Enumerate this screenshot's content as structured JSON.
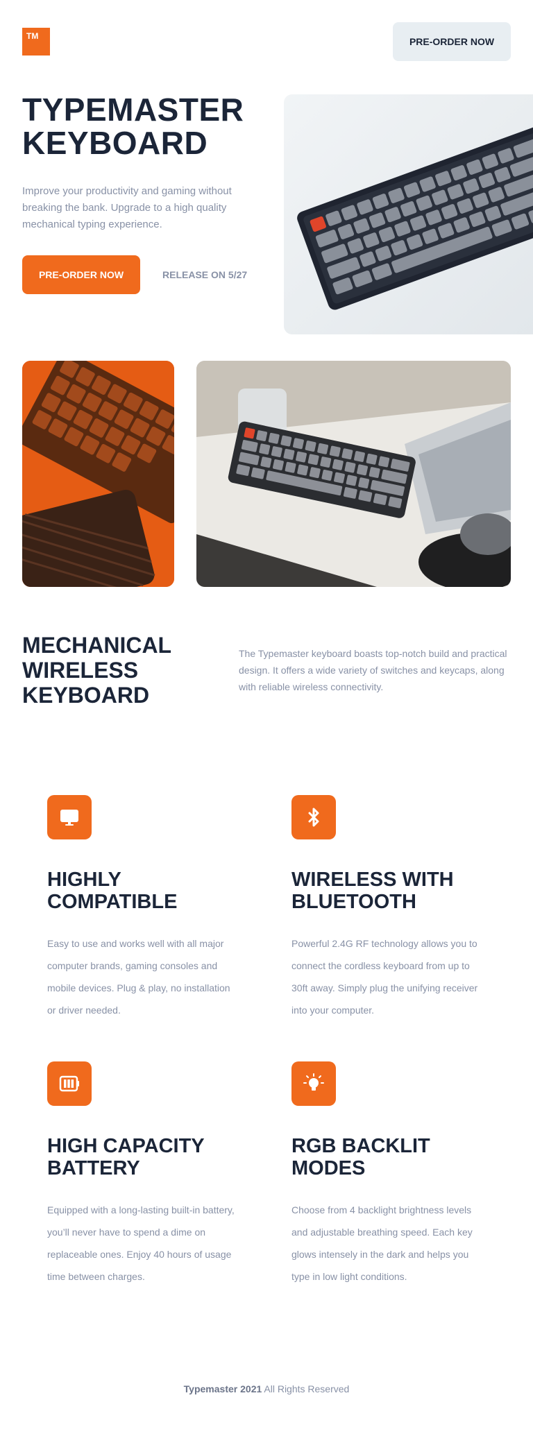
{
  "brand": {
    "logo": "TM",
    "accent": "#f06a1d"
  },
  "header": {
    "preorder_label": "PRE-ORDER NOW"
  },
  "hero": {
    "title": "TYPEMASTER KEYBOARD",
    "description": "Improve your productivity and gaming without breaking the bank. Upgrade to a high quality mechanical typing experience.",
    "preorder_label": "PRE-ORDER NOW",
    "release": "RELEASE ON 5/27"
  },
  "about": {
    "title": "MECHANICAL WIRELESS KEYBOARD",
    "description": "The Typemaster keyboard boasts top-notch build and practical design. It offers a wide variety of switches and keycaps, along with reliable wireless connectivity."
  },
  "features": [
    {
      "icon": "monitor-icon",
      "title": "HIGHLY COMPATIBLE",
      "description": "Easy to use and works well with all major computer brands, gaming consoles and mobile devices. Plug & play, no installation or driver needed."
    },
    {
      "icon": "bluetooth-icon",
      "title": "WIRELESS WITH BLUETOOTH",
      "description": "Powerful 2.4G RF technology allows you to connect the cordless keyboard from up to 30ft away. Simply plug the unifying receiver into your computer."
    },
    {
      "icon": "battery-icon",
      "title": "HIGH CAPACITY BATTERY",
      "description": "Equipped with a long-lasting built-in battery, you’ll never have to spend a dime on replaceable ones. Enjoy 40 hours of usage time between charges."
    },
    {
      "icon": "lightbulb-icon",
      "title": "RGB BACKLIT MODES",
      "description": "Choose from 4 backlight brightness levels and adjustable breathing speed. Each key glows intensely in the dark and helps you type in low light conditions."
    }
  ],
  "footer": {
    "brand": "Typemaster 2021",
    "rights": "All Rights Reserved"
  }
}
